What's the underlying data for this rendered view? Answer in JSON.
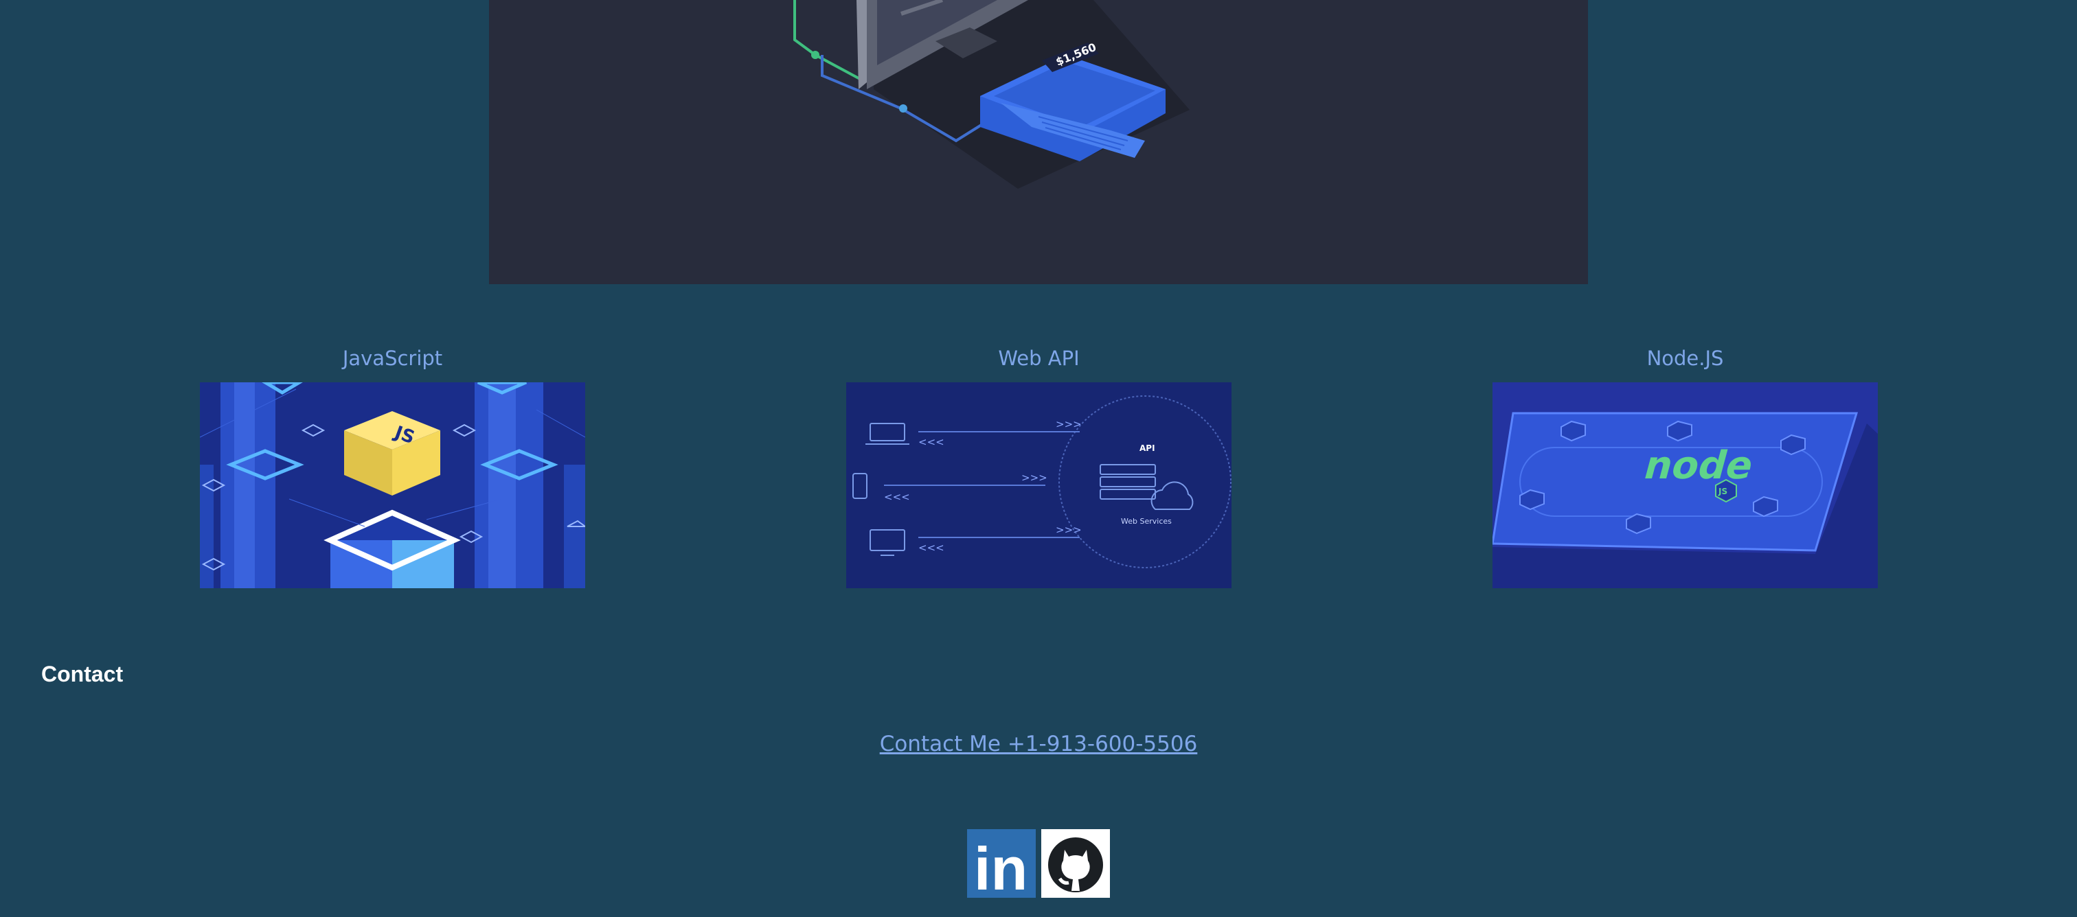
{
  "hero": {
    "price_tag": "$1,560"
  },
  "skills": [
    {
      "title": "JavaScript",
      "badge": "JS"
    },
    {
      "title": "Web API",
      "diagram_label": "API",
      "cloud_label": "Web Services",
      "arrow_right": ">>>",
      "arrow_left": "<<<"
    },
    {
      "title": "Node.JS",
      "logo_text": "node",
      "badge": "JS"
    }
  ],
  "contact": {
    "heading": "Contact",
    "link_text": "Contact Me +1-913-600-5506"
  },
  "social": {
    "linkedin_text": "in",
    "colors": {
      "linkedin": "#2d6eb0",
      "github_bg": "#ffffff"
    },
    "icons": [
      "linkedin-icon",
      "github-icon"
    ]
  },
  "colors": {
    "page_bg": "#1c445a",
    "hero_bg": "#282c3c",
    "title_text": "#7fa6e8"
  }
}
